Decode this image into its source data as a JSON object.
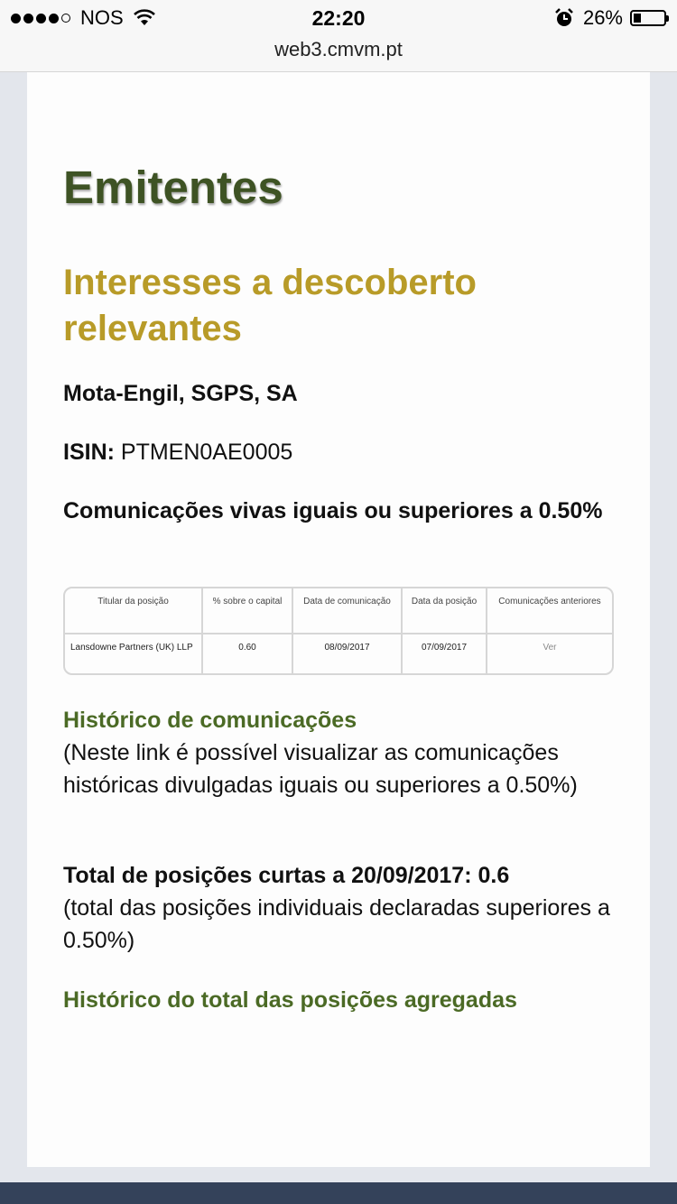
{
  "status": {
    "carrier": "NOS",
    "time": "22:20",
    "battery": "26%",
    "battery_level": 0.26,
    "icons": [
      "signal-icon",
      "wifi-icon",
      "alarm-icon",
      "battery-icon"
    ]
  },
  "browser": {
    "url": "web3.cmvm.pt"
  },
  "page": {
    "section_title": "Emitentes",
    "heading": "Interesses a descoberto relevantes",
    "company": "Mota-Engil, SGPS, SA",
    "isin_label": "ISIN:",
    "isin_value": "PTMEN0AE0005",
    "communications_title": "Comunicações vivas iguais ou superiores a 0.50%"
  },
  "table": {
    "headers": [
      "Titular da posição",
      "% sobre o capital",
      "Data de comunicação",
      "Data da posição",
      "Comunicações anteriores"
    ],
    "rows": [
      {
        "holder": "Lansdowne Partners (UK) LLP",
        "percent": "0.60",
        "comm_date": "08/09/2017",
        "position_date": "07/09/2017",
        "previous": "Ver"
      }
    ]
  },
  "history": {
    "link_label": "Histórico de comunicações",
    "description": "(Neste link é possível visualizar as comunicações históricas divulgadas iguais ou superiores a 0.50%)"
  },
  "total": {
    "label": "Total de posições curtas a 20/09/2017: 0.6",
    "description": "(total das posições individuais declaradas superiores a 0.50%)"
  },
  "aggregate": {
    "link_label": "Histórico do total das posições agregadas"
  },
  "colors": {
    "title_green": "#3e5324",
    "heading_gold": "#b89b28",
    "link_green": "#4b6a25",
    "bottom_bar": "#34425a"
  }
}
